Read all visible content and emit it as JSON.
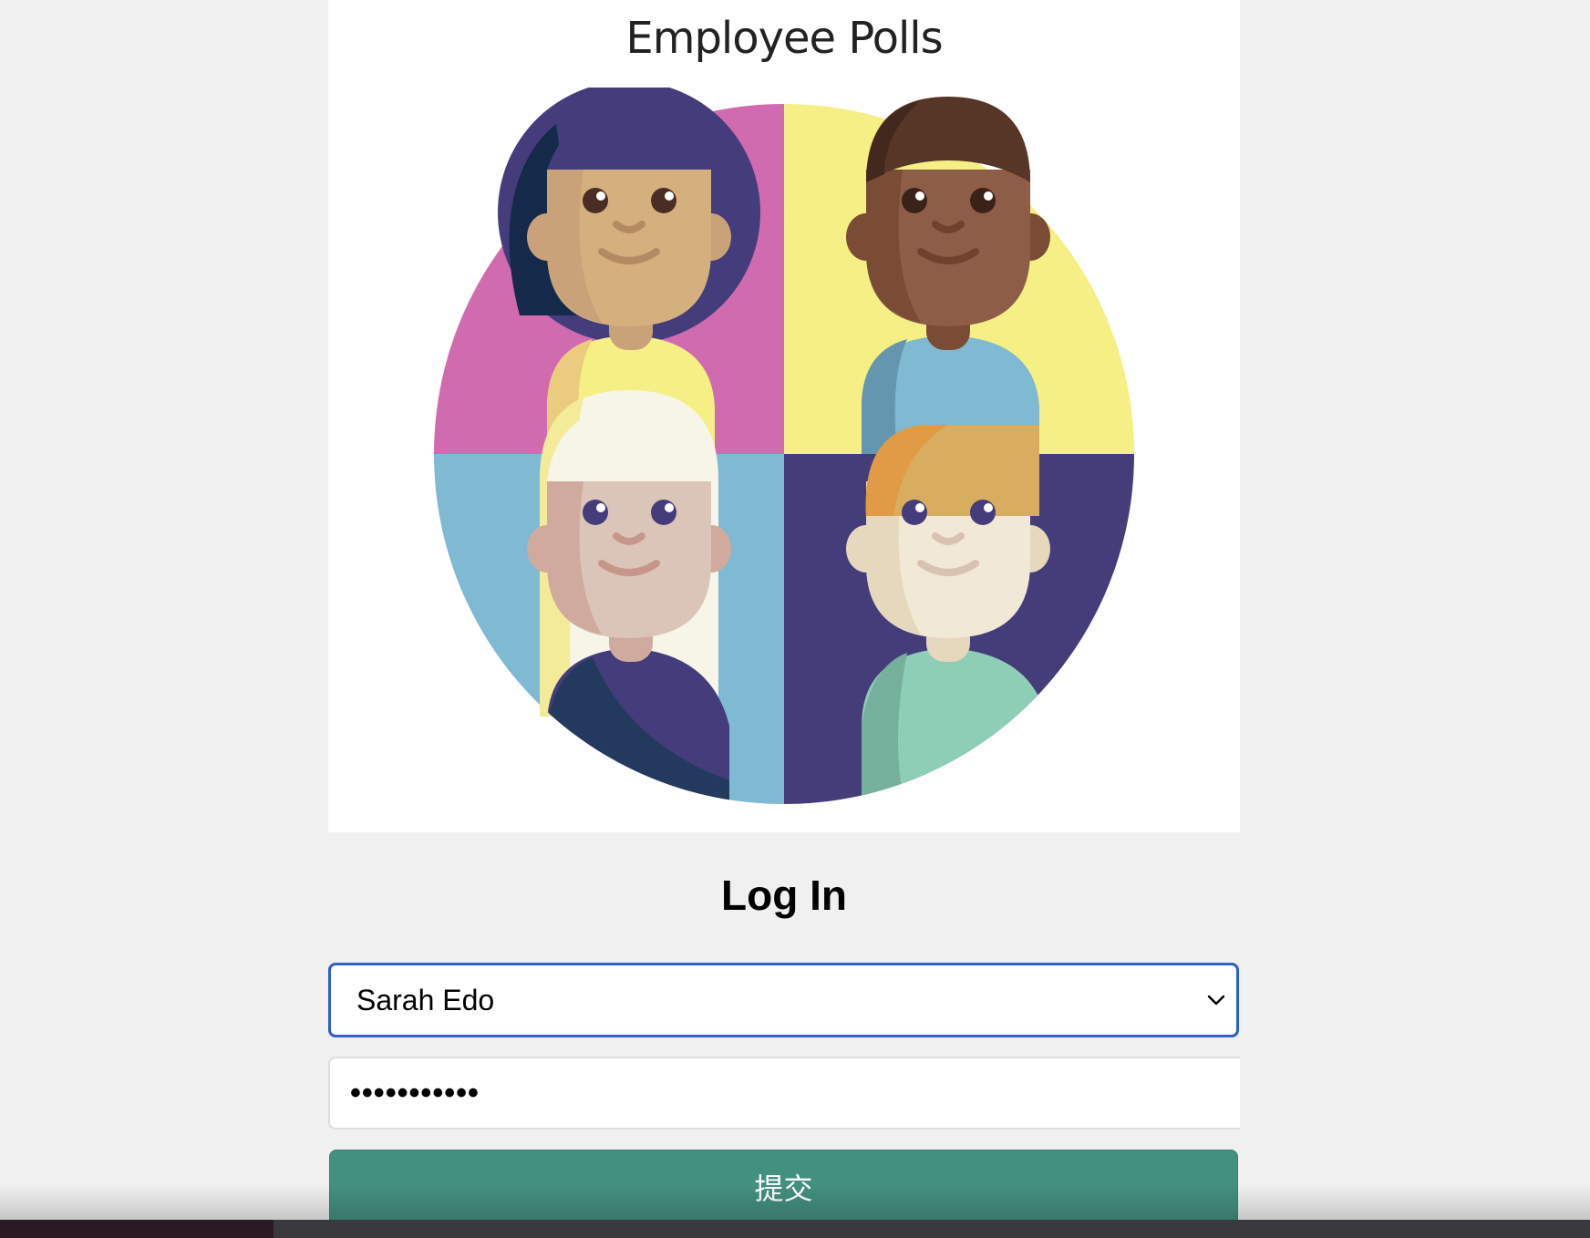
{
  "hero": {
    "title": "Employee Polls"
  },
  "login": {
    "title": "Log In",
    "user_select": {
      "selected": "Sarah Edo"
    },
    "password": {
      "value": "•••••••••••"
    },
    "submit_label": "提交"
  },
  "colors": {
    "accent": "#43907f",
    "focus_border": "#2f5fc9",
    "background": "#f0f0f0"
  },
  "icons": {
    "select_arrow": "chevron-down-icon"
  }
}
